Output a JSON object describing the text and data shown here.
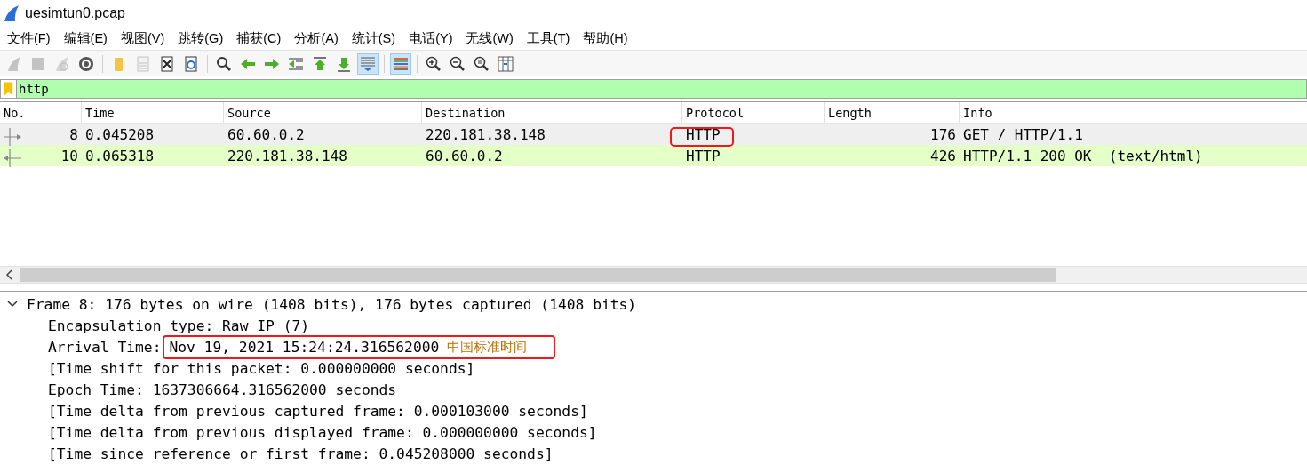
{
  "window": {
    "title": "uesimtun0.pcap"
  },
  "menu": [
    {
      "label": "文件(F)"
    },
    {
      "label": "编辑(E)"
    },
    {
      "label": "视图(V)"
    },
    {
      "label": "跳转(G)"
    },
    {
      "label": "捕获(C)"
    },
    {
      "label": "分析(A)"
    },
    {
      "label": "统计(S)"
    },
    {
      "label": "电话(Y)"
    },
    {
      "label": "无线(W)"
    },
    {
      "label": "工具(T)"
    },
    {
      "label": "帮助(H)"
    }
  ],
  "toolbar": [
    [
      {
        "kind": "start",
        "disabled": true,
        "pressed": false
      },
      {
        "kind": "stop",
        "disabled": true,
        "pressed": false
      },
      {
        "kind": "restart",
        "disabled": true,
        "pressed": false
      },
      {
        "kind": "options",
        "disabled": false,
        "pressed": false
      }
    ],
    [
      {
        "kind": "open",
        "disabled": false,
        "pressed": false
      },
      {
        "kind": "save",
        "disabled": true,
        "pressed": false
      },
      {
        "kind": "close",
        "disabled": false,
        "pressed": false
      },
      {
        "kind": "reload",
        "disabled": false,
        "pressed": false
      }
    ],
    [
      {
        "kind": "find",
        "disabled": false,
        "pressed": false
      },
      {
        "kind": "back",
        "disabled": false,
        "pressed": false
      },
      {
        "kind": "forward",
        "disabled": false,
        "pressed": false
      },
      {
        "kind": "goto",
        "disabled": false,
        "pressed": false
      },
      {
        "kind": "first",
        "disabled": false,
        "pressed": false
      },
      {
        "kind": "last",
        "disabled": false,
        "pressed": false
      },
      {
        "kind": "autoscroll",
        "disabled": false,
        "pressed": true
      }
    ],
    [
      {
        "kind": "colorize",
        "disabled": false,
        "pressed": true
      }
    ],
    [
      {
        "kind": "zoom-in",
        "disabled": false,
        "pressed": false
      },
      {
        "kind": "zoom-out",
        "disabled": false,
        "pressed": false
      },
      {
        "kind": "zoom-normal",
        "disabled": false,
        "pressed": false
      },
      {
        "kind": "resize-columns",
        "disabled": false,
        "pressed": false
      }
    ]
  ],
  "filter": {
    "value": "http",
    "valid": true
  },
  "packet_list": {
    "columns": [
      "No.",
      "Time",
      "Source",
      "Destination",
      "Protocol",
      "Length",
      "Info"
    ],
    "rows": [
      {
        "no": "8",
        "time": "0.045208",
        "source": "60.60.0.2",
        "destination": "220.181.38.148",
        "protocol": "HTTP",
        "length": "176",
        "info": "GET / HTTP/1.1",
        "kind": "request",
        "selected": true,
        "protocol_marked": true
      },
      {
        "no": "10",
        "time": "0.065318",
        "source": "220.181.38.148",
        "destination": "60.60.0.2",
        "protocol": "HTTP",
        "length": "426",
        "info": "HTTP/1.1 200 OK  (text/html)",
        "kind": "response",
        "selected": false,
        "protocol_marked": false
      }
    ]
  },
  "details": [
    {
      "text": "Frame 8: 176 bytes on wire (1408 bits), 176 bytes captured (1408 bits)",
      "expanded": true,
      "children": [
        {
          "text": "Encapsulation type: Raw IP (7)"
        },
        {
          "text": "Arrival Time:",
          "value": "Nov 19, 2021 15:24:24.316562000",
          "note": "中国标准时间",
          "marked": true
        },
        {
          "text": "[Time shift for this packet: 0.000000000 seconds]"
        },
        {
          "text": "Epoch Time: 1637306664.316562000 seconds"
        },
        {
          "text": "[Time delta from previous captured frame: 0.000103000 seconds]"
        },
        {
          "text": "[Time delta from previous displayed frame: 0.000000000 seconds]"
        },
        {
          "text": "[Time since reference or first frame: 0.045208000 seconds]"
        }
      ]
    }
  ]
}
